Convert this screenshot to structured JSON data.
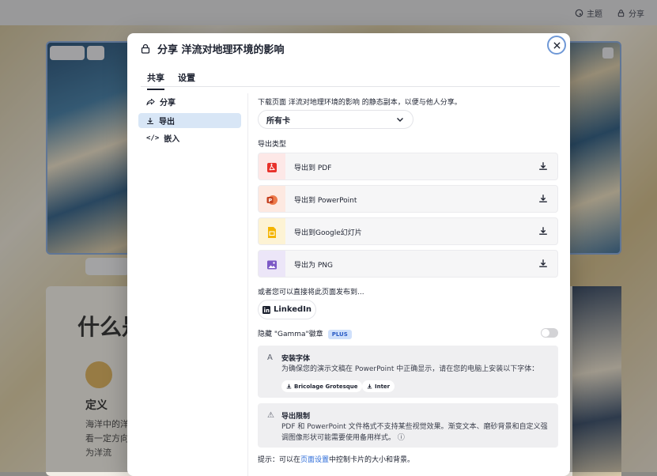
{
  "topbar": {
    "theme_label": "主题",
    "share_label": "分享"
  },
  "background": {
    "card_heading": "什么是",
    "card_def_title": "定义",
    "card_lines": [
      "海洋中的洋",
      "看一定方向",
      "为洋流"
    ]
  },
  "modal": {
    "title": "分享 洋流对地理环境的影响",
    "tabs": [
      {
        "label": "共享"
      },
      {
        "label": "设置"
      }
    ],
    "sidebar": [
      {
        "label": "分享",
        "icon": "share-icon"
      },
      {
        "label": "导出",
        "icon": "download-icon"
      },
      {
        "label": "嵌入",
        "icon": "code-icon"
      }
    ],
    "description": "下载页面 洋流对地理环境的影响 的静态副本，以便与他人分享。",
    "card_select": "所有卡",
    "export_type_label": "导出类型",
    "exports": [
      {
        "label": "导出到 PDF",
        "icon": "pdf-icon",
        "color": "#e8322b",
        "bg": "#fde8e7"
      },
      {
        "label": "导出到 PowerPoint",
        "icon": "powerpoint-icon",
        "color": "#d35230",
        "bg": "#fde9e1"
      },
      {
        "label": "导出到Google幻灯片",
        "icon": "google-slides-icon",
        "color": "#f4b400",
        "bg": "#fdf3d4"
      },
      {
        "label": "导出为 PNG",
        "icon": "image-icon",
        "color": "#7c59c6",
        "bg": "#ece6f8"
      }
    ],
    "publish_label": "或者您可以直接将此页面发布到...",
    "linkedin_label": "LinkedIn",
    "hide_badge_label": "隐藏 \"Gamma\"徽章",
    "plus_badge": "PLUS",
    "fonts_panel": {
      "title": "安装字体",
      "body": "为确保您的演示文稿在 PowerPoint 中正确显示，请在您的电脑上安装以下字体：",
      "fonts": [
        "Bricolage Grotesque",
        "Inter"
      ]
    },
    "limits_panel": {
      "title": "导出限制",
      "body": "PDF 和 PowerPoint 文件格式不支持某些视觉效果。渐变文本、磨砂背景和自定义强调图像形状可能需要使用备用样式。"
    },
    "tip_prefix": "提示：可以在",
    "tip_link": "页面设置",
    "tip_suffix": "中控制卡片的大小和背景。"
  }
}
